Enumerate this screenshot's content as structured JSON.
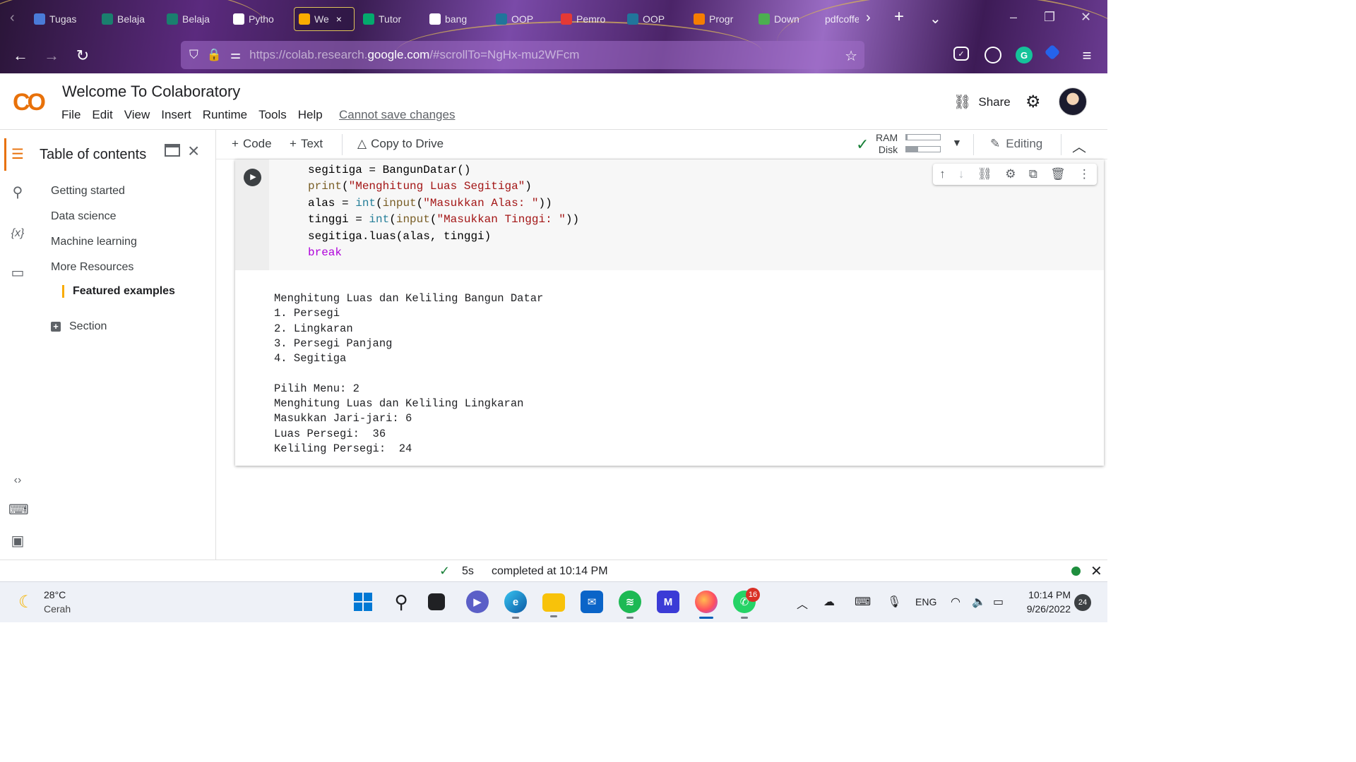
{
  "browser": {
    "tabs": [
      {
        "label": "Tugas",
        "icon": "people-icon",
        "color": "#4a7bd8"
      },
      {
        "label": "Belaja",
        "icon": "graduation-cap-icon",
        "color": "#1a7f6e"
      },
      {
        "label": "Belaja",
        "icon": "graduation-cap-icon",
        "color": "#1a7f6e"
      },
      {
        "label": "Pytho",
        "icon": "dg-icon",
        "color": "#ffffff"
      },
      {
        "label": "We",
        "icon": "colab-icon",
        "color": "#f9ab00"
      },
      {
        "label": "Tutor",
        "icon": "w3-icon",
        "color": "#04aa6d"
      },
      {
        "label": "bang",
        "icon": "google-icon",
        "color": "#ffffff"
      },
      {
        "label": "OOP",
        "icon": "wordpress-icon",
        "color": "#21759b"
      },
      {
        "label": "Pemro",
        "icon": "pdf-icon",
        "color": "#e53935"
      },
      {
        "label": "OOP",
        "icon": "wordpress-icon",
        "color": "#21759b"
      },
      {
        "label": "Progr",
        "icon": "blogger-icon",
        "color": "#f57d00"
      },
      {
        "label": "Down",
        "icon": "download-icon",
        "color": "#4caf50"
      },
      {
        "label": "pdfcoffe",
        "icon": "",
        "color": ""
      }
    ],
    "active_tab_index": 4,
    "url_prefix": "https://colab.research.",
    "url_domain": "google.com",
    "url_suffix": "/#scrollTo=NgHx-mu2WFcm"
  },
  "colab": {
    "logo": "CO",
    "title": "Welcome To Colaboratory",
    "menu": [
      "File",
      "Edit",
      "View",
      "Insert",
      "Runtime",
      "Tools",
      "Help"
    ],
    "cannot_save": "Cannot save changes",
    "share_label": "Share"
  },
  "sidebar": {
    "title": "Table of contents",
    "items": [
      "Getting started",
      "Data science",
      "Machine learning",
      "More Resources"
    ],
    "featured": "Featured examples",
    "section_label": "Section"
  },
  "toolbar": {
    "code_label": "Code",
    "text_label": "Text",
    "copy_label": "Copy to Drive",
    "ram_label": "RAM",
    "disk_label": "Disk",
    "ram_fill": 0.05,
    "disk_fill": 0.35,
    "editing_label": "Editing"
  },
  "cell": {
    "code_lines": [
      [
        [
          "",
          "segitiga = BangunDatar()"
        ]
      ],
      [
        [
          "fn",
          "print"
        ],
        [
          "",
          "("
        ],
        [
          "str",
          "\"Menghitung Luas Segitiga\""
        ],
        [
          "",
          ")"
        ]
      ],
      [
        [
          "",
          "alas = "
        ],
        [
          "bi",
          "int"
        ],
        [
          "",
          "("
        ],
        [
          "fn",
          "input"
        ],
        [
          "",
          "("
        ],
        [
          "str",
          "\"Masukkan Alas: \""
        ],
        [
          "",
          "))"
        ]
      ],
      [
        [
          "",
          "tinggi = "
        ],
        [
          "bi",
          "int"
        ],
        [
          "",
          "("
        ],
        [
          "fn",
          "input"
        ],
        [
          "",
          "("
        ],
        [
          "str",
          "\"Masukkan Tinggi: \""
        ],
        [
          "",
          "))"
        ]
      ],
      [
        [
          "",
          "segitiga.luas(alas, tinggi)"
        ]
      ],
      [
        [
          "kw",
          "break"
        ]
      ]
    ],
    "output_lines": [
      "Menghitung Luas dan Keliling Bangun Datar",
      "1. Persegi",
      "2. Lingkaran",
      "3. Persegi Panjang",
      "4. Segitiga",
      "",
      "Pilih Menu: 2",
      "Menghitung Luas dan Keliling Lingkaran",
      "Masukkan Jari-jari: 6",
      "Luas Persegi:  36",
      "Keliling Persegi:  24"
    ]
  },
  "status": {
    "duration": "5s",
    "message": "completed at 10:14 PM"
  },
  "taskbar": {
    "temperature": "28°C",
    "weather": "Cerah",
    "whatsapp_badge": "16",
    "language": "ENG",
    "time": "10:14 PM",
    "date": "9/26/2022",
    "notifications": "24"
  }
}
